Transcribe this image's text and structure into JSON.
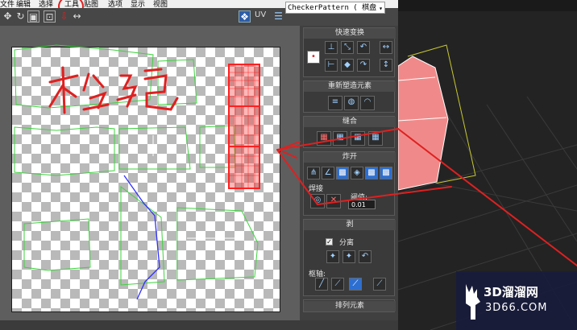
{
  "menu": {
    "items": [
      "文件",
      "编辑",
      "选择",
      "工具",
      "贴图",
      "选项",
      "显示",
      "视图"
    ]
  },
  "toolbar": {
    "uv_label": "UV",
    "checker_value": "CheckerPattern  ( 棋盘",
    "checker_arrow": "▾"
  },
  "panel": {
    "quick_transform": {
      "title": "快速变换"
    },
    "reshape": {
      "title": "重新塑造元素"
    },
    "stitch": {
      "title": "缝合"
    },
    "explode": {
      "title": "炸开"
    },
    "weld": {
      "label": "焊接",
      "threshold_label": "阈值:",
      "threshold_value": "0.01"
    },
    "peel": {
      "title": "剥",
      "separate_label": "分离",
      "separate_checked": true,
      "pivot_label": "枢轴:"
    },
    "arrange": {
      "title": "排列元素"
    }
  },
  "annotation": {
    "handwritten_text": "松弛",
    "stroke_color": "#e02020"
  },
  "watermark": {
    "title": "3D溜溜网",
    "url": "3D66.COM"
  },
  "colors": {
    "accent_red": "#e02020",
    "uv_green": "#3fd23f",
    "selection_red": "#ff2020",
    "object_pink": "#f08a8a"
  }
}
